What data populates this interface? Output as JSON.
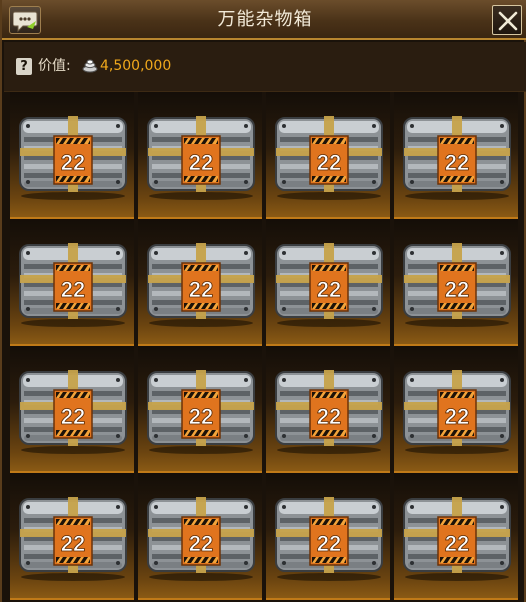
{
  "window": {
    "title": "万能杂物箱"
  },
  "value": {
    "label": "价值:",
    "amount": "4,500,000",
    "amount_color": "#f0a81c"
  },
  "icons": {
    "chat": "chat-bubble-icon",
    "close": "close-icon",
    "help": "question-icon",
    "currency": "coin-icon"
  },
  "help_glyph": "?",
  "items": [
    {
      "name": "crate",
      "badge": "22"
    },
    {
      "name": "crate",
      "badge": "22"
    },
    {
      "name": "crate",
      "badge": "22"
    },
    {
      "name": "crate",
      "badge": "22"
    },
    {
      "name": "crate",
      "badge": "22"
    },
    {
      "name": "crate",
      "badge": "22"
    },
    {
      "name": "crate",
      "badge": "22"
    },
    {
      "name": "crate",
      "badge": "22"
    },
    {
      "name": "crate",
      "badge": "22"
    },
    {
      "name": "crate",
      "badge": "22"
    },
    {
      "name": "crate",
      "badge": "22"
    },
    {
      "name": "crate",
      "badge": "22"
    },
    {
      "name": "crate",
      "badge": "22"
    },
    {
      "name": "crate",
      "badge": "22"
    },
    {
      "name": "crate",
      "badge": "22"
    },
    {
      "name": "crate",
      "badge": "22"
    }
  ]
}
